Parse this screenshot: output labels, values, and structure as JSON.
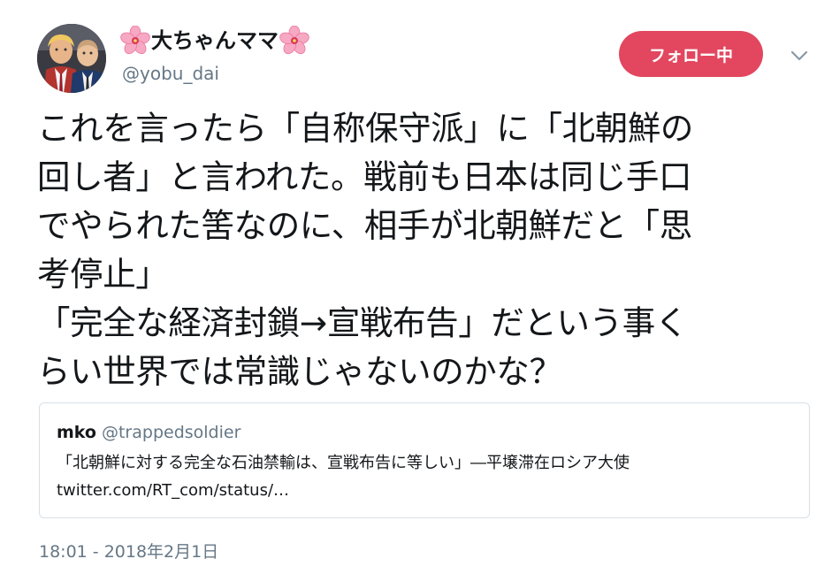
{
  "author": {
    "display_name": "大ちゃんママ",
    "handle": "@yobu_dai",
    "name_decoration_icon": "cherry-blossom-emoji"
  },
  "follow_button": {
    "label": "フォロー中",
    "color": "#e2475f"
  },
  "more_menu_icon": "chevron-down-icon",
  "tweet": {
    "lines": [
      "これを言ったら「自称保守派」に「北朝鮮の",
      "回し者」と言われた。戦前も日本は同じ手口",
      "でやられた筈なのに、相手が北朝鮮だと「思",
      "考停止」",
      "「完全な経済封鎖→宣戦布告」だという事く",
      "らい世界では常識じゃないのかな？"
    ]
  },
  "quote": {
    "name": "mko",
    "handle": "@trappedsoldier",
    "text": "「北朝鮮に対する完全な石油禁輸は、宣戦布告に等しい」―平壌滞在ロシア大使",
    "link": "twitter.com/RT_com/status/…"
  },
  "timestamp": "18:01 - 2018年2月1日",
  "colors": {
    "text": "#14171a",
    "secondary": "#657786",
    "border": "#d8e0e6",
    "accent": "#e2475f"
  }
}
